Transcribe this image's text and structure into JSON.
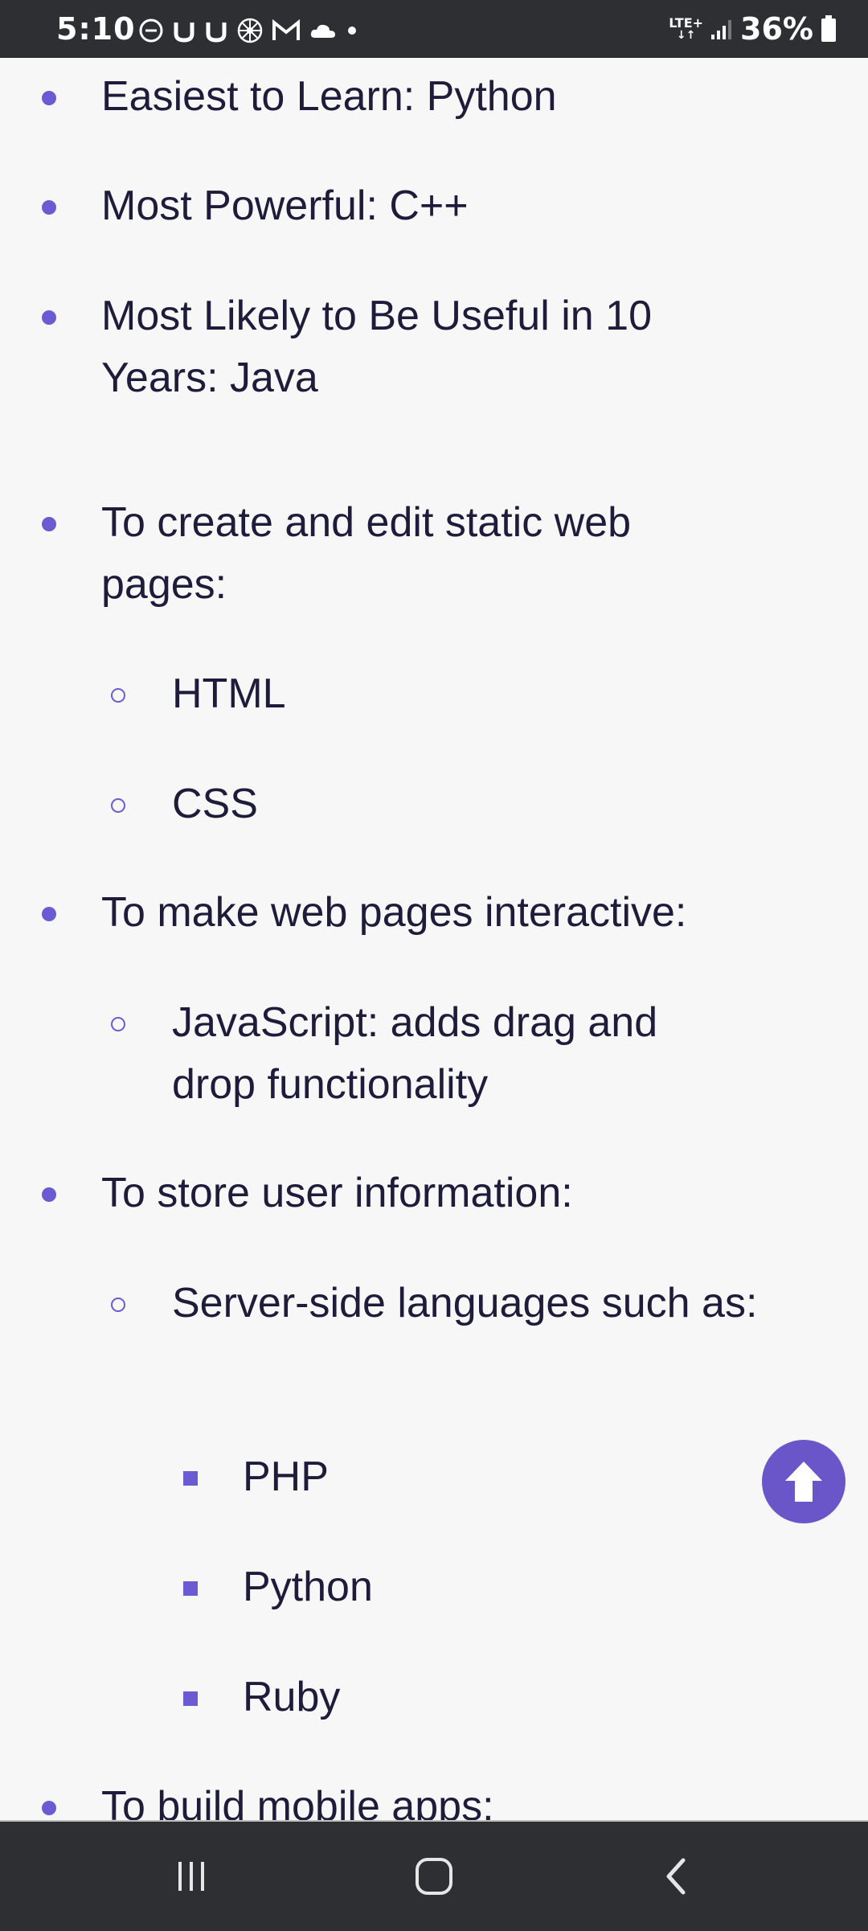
{
  "status_bar": {
    "time": "5:10",
    "network": "LTE+",
    "battery": "36%",
    "notification_icons": [
      "do-not-disturb-icon",
      "u-app-icon",
      "u-app-icon",
      "flower-app-icon",
      "gmail-icon",
      "cloud-app-icon",
      "dot-icon"
    ]
  },
  "content": {
    "items": [
      {
        "level": 1,
        "text": "Easiest to Learn: Python"
      },
      {
        "level": 1,
        "text": "Most Powerful: C++"
      },
      {
        "level": 1,
        "text": "Most Likely to Be Useful in 10 Years: Java"
      },
      {
        "level": 1,
        "text": "To create and edit static web pages:"
      },
      {
        "level": 2,
        "text": "HTML"
      },
      {
        "level": 2,
        "text": "CSS"
      },
      {
        "level": 1,
        "text": "To make web pages interactive:"
      },
      {
        "level": 2,
        "text": "JavaScript: adds drag and drop functionality"
      },
      {
        "level": 1,
        "text": "To store user information:"
      },
      {
        "level": 2,
        "text": "Server-side languages such as:"
      },
      {
        "level": 3,
        "text": "PHP"
      },
      {
        "level": 3,
        "text": "Python"
      },
      {
        "level": 3,
        "text": "Ruby"
      },
      {
        "level": 1,
        "text": "To build mobile apps:"
      }
    ]
  },
  "scroll_to_top": {
    "icon": "arrow-up-icon"
  },
  "nav_bar": {
    "recent_icon": "recent-apps-icon",
    "home_icon": "home-icon",
    "back_icon": "back-icon"
  },
  "colors": {
    "accent": "#6b5bd2",
    "text": "#1f1c3b",
    "background": "#f7f7f8",
    "system_bar": "#2d2f33"
  }
}
